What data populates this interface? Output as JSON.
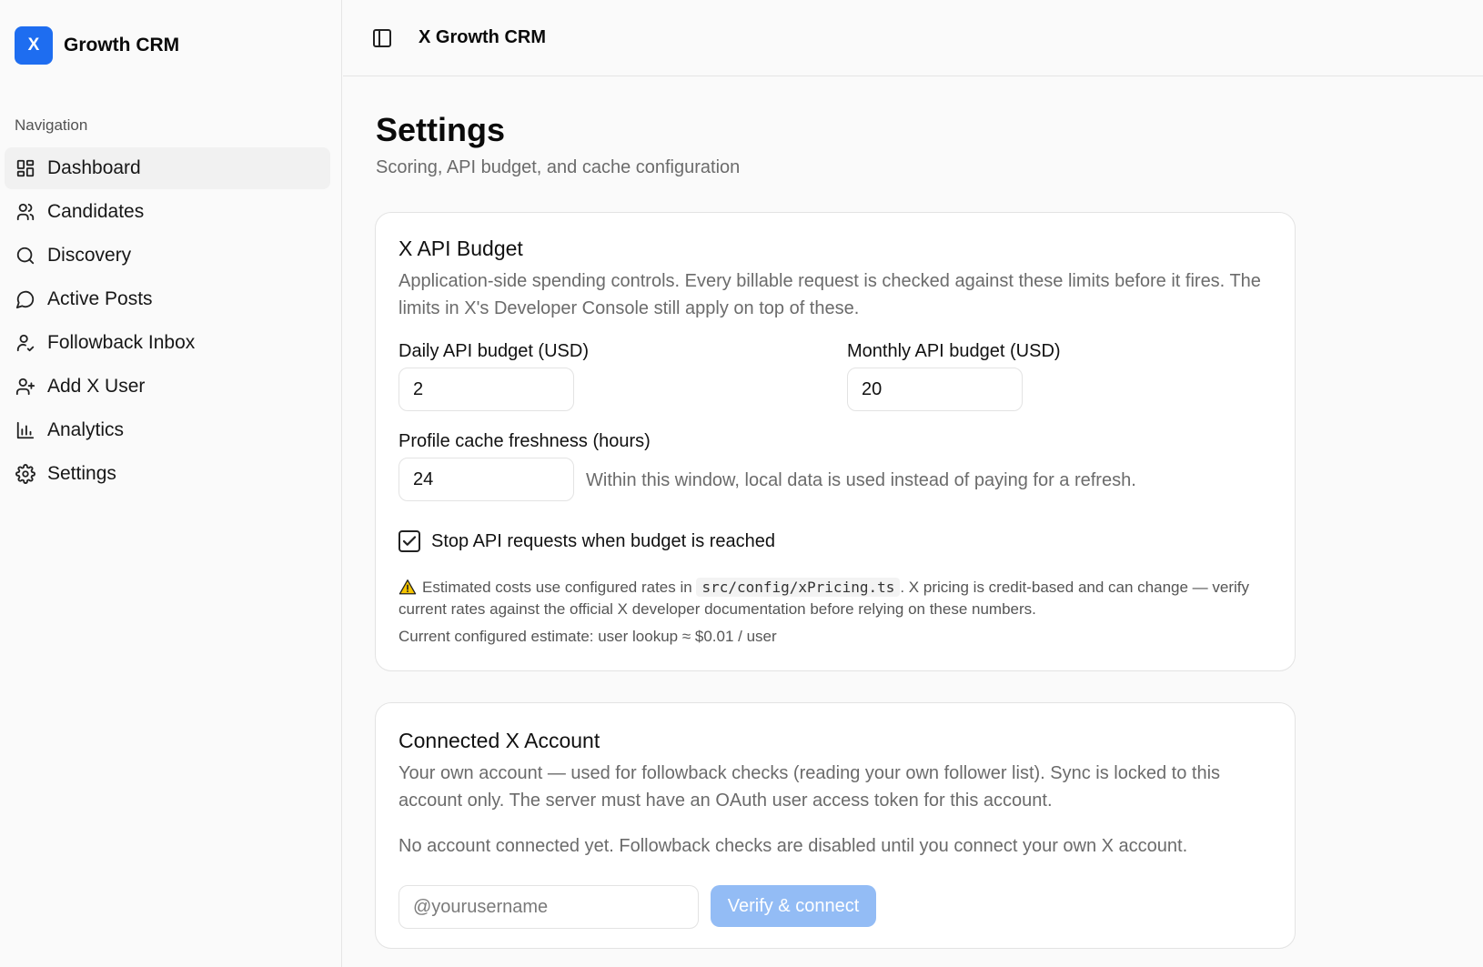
{
  "brand": {
    "logo_letter": "X",
    "name": "Growth CRM"
  },
  "nav": {
    "heading": "Navigation",
    "items": [
      {
        "label": "Dashboard",
        "icon": "dashboard-icon",
        "active": true
      },
      {
        "label": "Candidates",
        "icon": "users-icon"
      },
      {
        "label": "Discovery",
        "icon": "search-icon"
      },
      {
        "label": "Active Posts",
        "icon": "message-circle-icon"
      },
      {
        "label": "Followback Inbox",
        "icon": "user-check-icon"
      },
      {
        "label": "Add X User",
        "icon": "user-plus-icon"
      },
      {
        "label": "Analytics",
        "icon": "bar-chart-icon"
      },
      {
        "label": "Settings",
        "icon": "gear-icon"
      }
    ]
  },
  "header": {
    "title": "X Growth CRM",
    "toggle_icon": "panel-left-icon"
  },
  "page": {
    "title": "Settings",
    "subtitle": "Scoring, API budget, and cache configuration"
  },
  "budget_card": {
    "title": "X API Budget",
    "description": "Application-side spending controls. Every billable request is checked against these limits before it fires. The limits in X's Developer Console still apply on top of these.",
    "daily_label": "Daily API budget (USD)",
    "daily_value": "2",
    "monthly_label": "Monthly API budget (USD)",
    "monthly_value": "20",
    "cache_label": "Profile cache freshness (hours)",
    "cache_value": "24",
    "cache_hint": "Within this window, local data is used instead of paying for a refresh.",
    "stop_label": "Stop API requests when budget is reached",
    "stop_checked": true,
    "note_prefix": "Estimated costs use configured rates in",
    "note_code": "src/config/xPricing.ts",
    "note_suffix": ". X pricing is credit-based and can change — verify current rates against the official X developer documentation before relying on these numbers.",
    "estimate": "Current configured estimate: user lookup ≈ $0.01 / user",
    "warning_icon": "warning-triangle-icon",
    "warning_color": "#e0b000"
  },
  "account_card": {
    "title": "Connected X Account",
    "description": "Your own account — used for followback checks (reading your own follower list). Sync is locked to this account only. The server must have an OAuth user access token for this account.",
    "status": "No account connected yet. Followback checks are disabled until you connect your own X account.",
    "username_placeholder": "@yourusername",
    "verify_label": "Verify & connect"
  },
  "colors": {
    "accent": "#1e6df0",
    "button_disabled": "#93bcf5"
  }
}
